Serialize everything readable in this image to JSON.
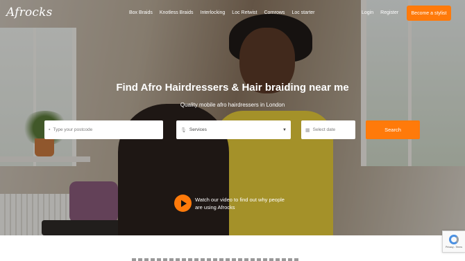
{
  "brand": {
    "logo_text": "Afrocks"
  },
  "nav": {
    "links": [
      "Box Braids",
      "Knotless Braids",
      "Interlocking",
      "Loc Retwist",
      "Cornrows",
      "Loc starter"
    ],
    "login": "Login",
    "register": "Register",
    "cta": "Become a stylist"
  },
  "hero": {
    "title": "Find Afro Hairdressers & Hair braiding near me",
    "subtitle": "Quality mobile afro hairdressers in London"
  },
  "search": {
    "postcode_placeholder": "Type your postcode",
    "services_value": "Services",
    "date_placeholder": "Select date",
    "button_label": "Search"
  },
  "video": {
    "text": "Watch our video to find out why people are using Afrocks"
  },
  "recaptcha": {
    "text": "Privacy - Terms"
  },
  "colors": {
    "accent": "#ff7a0a"
  },
  "icons": {
    "postcode": "location-icon",
    "services": "microphone-icon",
    "date": "calendar-icon",
    "play": "play-icon"
  }
}
